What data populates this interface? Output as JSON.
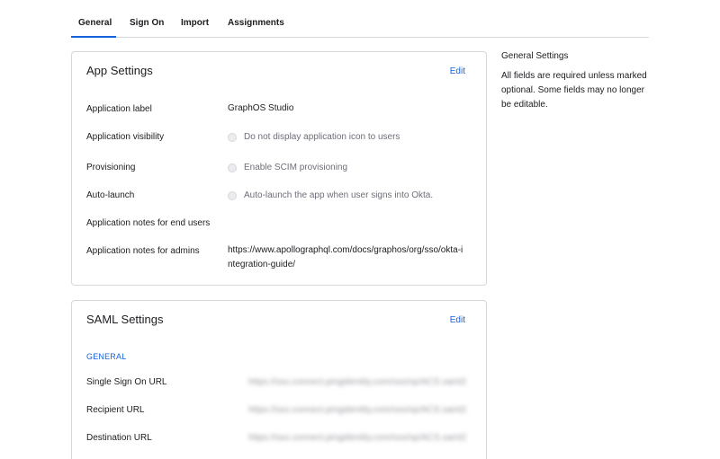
{
  "tabs": [
    {
      "label": "General",
      "active": true
    },
    {
      "label": "Sign On",
      "active": false
    },
    {
      "label": "Import",
      "active": false
    },
    {
      "label": "Assignments",
      "active": false
    }
  ],
  "app_settings": {
    "title": "App Settings",
    "edit_label": "Edit",
    "rows": {
      "app_label": {
        "label": "Application label",
        "value": "GraphOS Studio"
      },
      "visibility": {
        "label": "Application visibility",
        "option": "Do not display application icon to users"
      },
      "provisioning": {
        "label": "Provisioning",
        "option": "Enable SCIM provisioning"
      },
      "auto_launch": {
        "label": "Auto-launch",
        "option": "Auto-launch the app when user signs into Okta."
      },
      "notes_end_users": {
        "label": "Application notes for end users",
        "value": ""
      },
      "notes_admins": {
        "label": "Application notes for admins",
        "value": "https://www.apollographql.com/docs/graphos/org/sso/okta-integration-guide/"
      }
    }
  },
  "saml_settings": {
    "title": "SAML Settings",
    "edit_label": "Edit",
    "section": "GENERAL",
    "rows": {
      "sso_url": {
        "label": "Single Sign On URL",
        "value": "https://sso.connect.pingidentity.com/sso/sp/ACS.saml2"
      },
      "recipient_url": {
        "label": "Recipient URL",
        "value": "https://sso.connect.pingidentity.com/sso/sp/ACS.saml2"
      },
      "destination_url": {
        "label": "Destination URL",
        "value": "https://sso.connect.pingidentity.com/sso/sp/ACS.saml2"
      }
    }
  },
  "sidebar": {
    "title": "General Settings",
    "text": "All fields are required unless marked optional. Some fields may no longer be editable."
  }
}
